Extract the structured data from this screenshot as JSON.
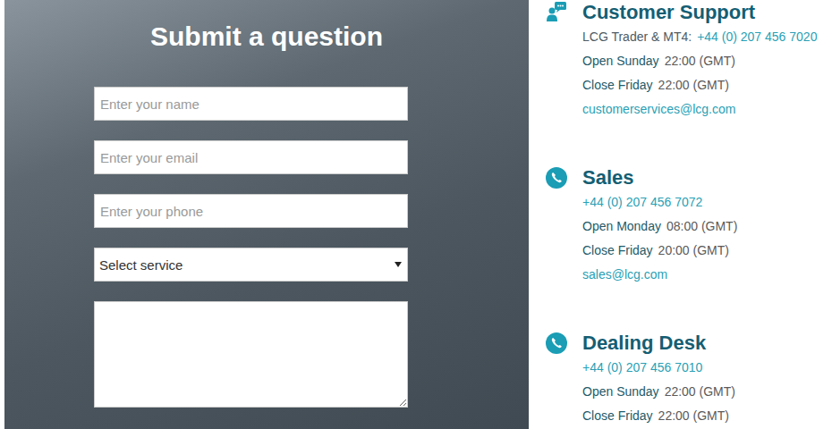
{
  "form": {
    "title": "Submit a question",
    "fields": [
      {
        "kind": "input",
        "placeholder": "Enter your name"
      },
      {
        "kind": "input",
        "placeholder": "Enter your email"
      },
      {
        "kind": "input",
        "placeholder": "Enter your phone"
      },
      {
        "kind": "select",
        "value": "Select service"
      },
      {
        "kind": "textarea",
        "placeholder": ""
      }
    ]
  },
  "contacts": [
    {
      "kind": "support",
      "title": "Customer Support",
      "lines": [
        {
          "kind": "link",
          "label": "LCG Trader & MT4:",
          "value": "+44 (0) 207 456 7020"
        },
        {
          "kind": "hours",
          "label": "Open Sunday",
          "value": "22:00 (GMT)"
        },
        {
          "kind": "hours",
          "label": "Close Friday",
          "value": "22:00 (GMT)"
        },
        {
          "kind": "link",
          "label": "",
          "value": "customerservices@lcg.com"
        }
      ]
    },
    {
      "kind": "phone",
      "title": "Sales",
      "lines": [
        {
          "kind": "link",
          "label": "",
          "value": "+44 (0) 207 456 7072"
        },
        {
          "kind": "hours",
          "label": "Open Monday",
          "value": "08:00 (GMT)"
        },
        {
          "kind": "hours",
          "label": "Close Friday",
          "value": "20:00 (GMT)"
        },
        {
          "kind": "link",
          "label": "",
          "value": "sales@lcg.com"
        }
      ]
    },
    {
      "kind": "phone",
      "title": "Dealing Desk",
      "lines": [
        {
          "kind": "link",
          "label": "",
          "value": "+44 (0) 207 456 7010"
        },
        {
          "kind": "hours",
          "label": "Open Sunday",
          "value": "22:00 (GMT)"
        },
        {
          "kind": "hours",
          "label": "Close Friday",
          "value": "22:00 (GMT)"
        }
      ]
    }
  ]
}
